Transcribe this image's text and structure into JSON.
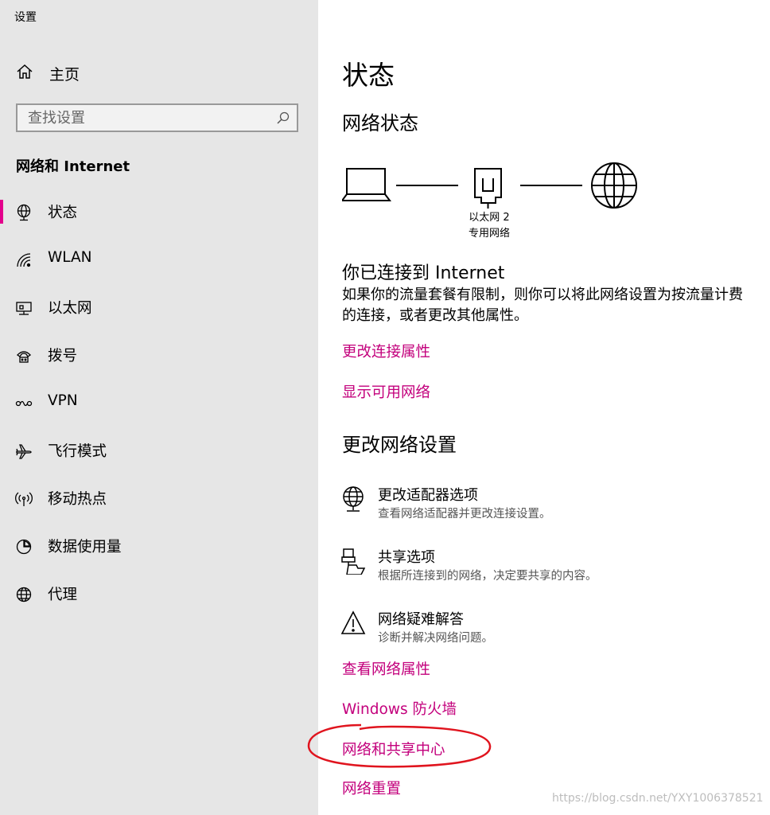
{
  "window": {
    "title": "设置"
  },
  "sidebar": {
    "home_label": "主页",
    "search_placeholder": "查找设置",
    "section_title": "网络和 Internet",
    "items": [
      {
        "label": "状态",
        "icon": "globe-status-icon",
        "active": true
      },
      {
        "label": "WLAN",
        "icon": "wifi-icon",
        "active": false
      },
      {
        "label": "以太网",
        "icon": "ethernet-icon",
        "active": false
      },
      {
        "label": "拨号",
        "icon": "dialup-icon",
        "active": false
      },
      {
        "label": "VPN",
        "icon": "vpn-icon",
        "active": false
      },
      {
        "label": "飞行模式",
        "icon": "airplane-icon",
        "active": false
      },
      {
        "label": "移动热点",
        "icon": "hotspot-icon",
        "active": false
      },
      {
        "label": "数据使用量",
        "icon": "data-usage-icon",
        "active": false
      },
      {
        "label": "代理",
        "icon": "globe-icon",
        "active": false
      }
    ]
  },
  "main": {
    "title": "状态",
    "network_status_heading": "网络状态",
    "adapter_name": "以太网 2",
    "network_type": "专用网络",
    "connected_title": "你已连接到 Internet",
    "connected_desc": "如果你的流量套餐有限制，则你可以将此网络设置为按流量计费的连接，或者更改其他属性。",
    "link_change_props": "更改连接属性",
    "link_show_networks": "显示可用网络",
    "change_settings_heading": "更改网络设置",
    "options": [
      {
        "title": "更改适配器选项",
        "desc": "查看网络适配器并更改连接设置。",
        "icon": "adapter-globe-icon"
      },
      {
        "title": "共享选项",
        "desc": "根据所连接到的网络，决定要共享的内容。",
        "icon": "sharing-icon"
      },
      {
        "title": "网络疑难解答",
        "desc": "诊断并解决网络问题。",
        "icon": "warning-icon"
      }
    ],
    "link_view_props": "查看网络属性",
    "link_firewall": "Windows 防火墙",
    "link_sharing_center": "网络和共享中心",
    "link_reset": "网络重置"
  },
  "watermark": "https://blog.csdn.net/YXY1006378521",
  "colors": {
    "accent": "#c3007c",
    "active_bar": "#e3008c",
    "sidebar_bg": "#e6e6e6",
    "annotation": "#e0141e"
  }
}
